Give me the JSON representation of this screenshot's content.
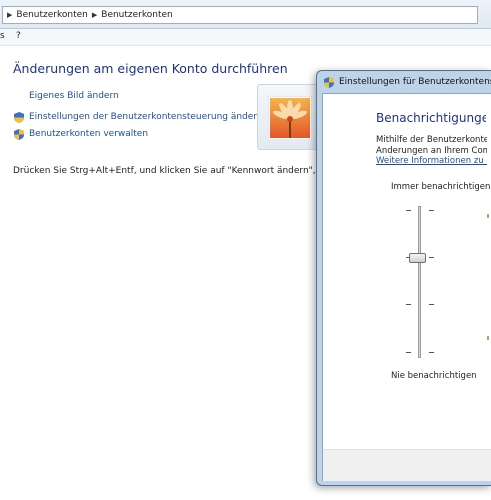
{
  "breadcrumb": [
    "Benutzerkonten",
    "Benutzerkonten"
  ],
  "menu": [
    "s",
    "?"
  ],
  "page": {
    "heading": "Änderungen am eigenen Konto durchführen",
    "links": [
      "Eigenes Bild ändern",
      "Einstellungen der Benutzerkontensteuerung ändern",
      "Benutzerkonten verwalten"
    ],
    "note": "Drücken Sie Strg+Alt+Entf, und klicken Sie auf \"Kennwort ändern\", um Ihr Ken"
  },
  "dialog": {
    "title": "Einstellungen für Benutzerkontensteue",
    "heading": "Benachrichtigungen ü",
    "text1": "Mithilfe der Benutzerkonte",
    "text2": "Änderungen an Ihrem Comp",
    "link": "Weitere Informationen zu de",
    "slider": {
      "top_label": "Immer benachrichtigen",
      "bottom_label": "Nie benachrichtigen",
      "level_from_bottom": 2,
      "levels": 4
    }
  },
  "colors": {
    "heading": "#1e3287",
    "link": "#1e4e9a",
    "dialog_frame": "#bcd3ea"
  }
}
